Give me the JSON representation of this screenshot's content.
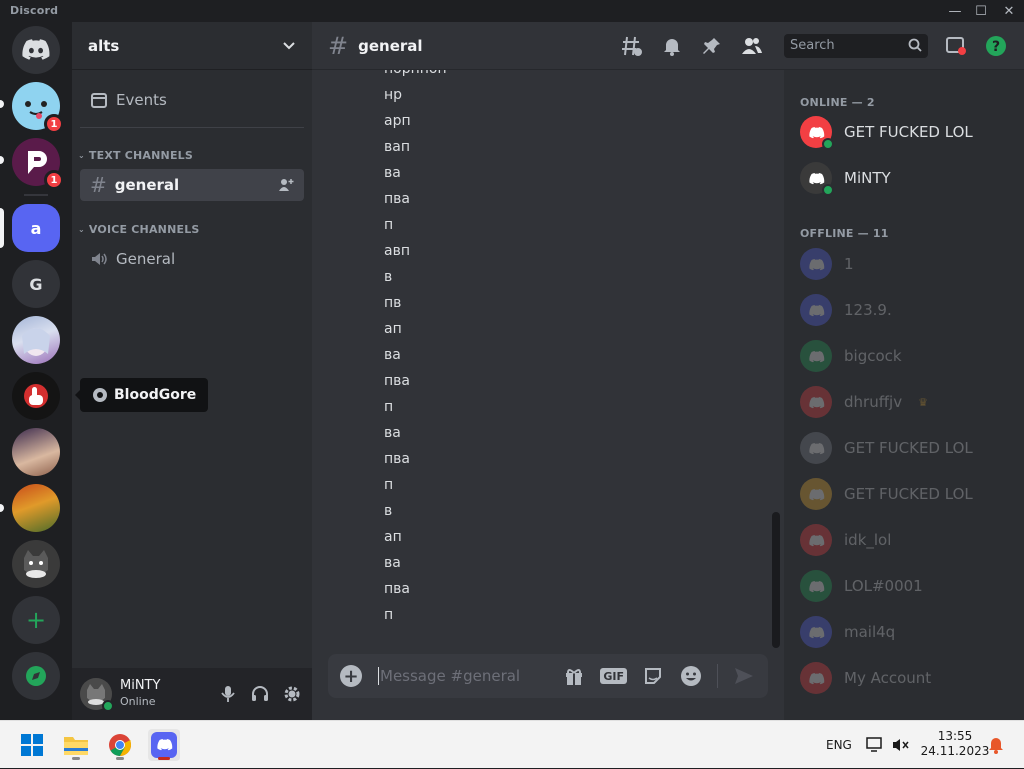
{
  "titlebar": {
    "brand": "Discord",
    "minimize": "—",
    "maximize": "☐",
    "close": "✕"
  },
  "rail": {
    "servers": [
      {
        "label": "",
        "color": "#5865f2",
        "badge": ""
      },
      {
        "label": "",
        "color": "#8fd3f0",
        "badge": "1"
      },
      {
        "label": "",
        "color": "#5a1b4a",
        "badge": "1"
      },
      {
        "label": "a",
        "color": "#5865f2",
        "badge": ""
      },
      {
        "label": "G",
        "color": "#313338",
        "badge": ""
      }
    ],
    "add_label": "+",
    "tooltip": "BloodGore"
  },
  "sidebar": {
    "server_name": "alts",
    "events": "Events",
    "text_category": "TEXT CHANNELS",
    "text_channel": "general",
    "voice_category": "VOICE CHANNELS",
    "voice_channel": "General"
  },
  "user": {
    "name": "MiNTY",
    "status": "Online"
  },
  "header": {
    "channel": "general",
    "search_placeholder": "Search"
  },
  "messages": [
    "порнноп",
    "нр",
    "арп",
    "вап",
    "ва",
    "пва",
    "п",
    "авп",
    "в",
    "пв",
    "ап",
    "ва",
    "пва",
    "п",
    "ва",
    "пва",
    "п",
    "в",
    "ап",
    "ва",
    "пва",
    "п"
  ],
  "composer": {
    "placeholder": "Message #general",
    "gif": "GIF"
  },
  "members": {
    "online_label": "ONLINE — 2",
    "online": [
      {
        "name": "GET FUCKED LOL",
        "color": "#f23f43"
      },
      {
        "name": "MiNTY",
        "color": "#3a3a3a"
      }
    ],
    "offline_label": "OFFLINE — 11",
    "offline": [
      {
        "name": "1",
        "color": "#5865f2"
      },
      {
        "name": "123.9.",
        "color": "#5865f2"
      },
      {
        "name": "bigcock",
        "color": "#23a55a"
      },
      {
        "name": "dhruffjv",
        "color": "#f23f43",
        "crown": "♛"
      },
      {
        "name": "GET FUCKED LOL",
        "color": "#80848e"
      },
      {
        "name": "GET FUCKED LOL",
        "color": "#f0b232"
      },
      {
        "name": "idk_lol",
        "color": "#f23f43"
      },
      {
        "name": "LOL#0001",
        "color": "#23a55a"
      },
      {
        "name": "mail4q",
        "color": "#5865f2"
      },
      {
        "name": "My Account",
        "color": "#f23f43"
      }
    ]
  },
  "taskbar": {
    "lang": "ENG",
    "time": "13:55",
    "date": "24.11.2023"
  }
}
